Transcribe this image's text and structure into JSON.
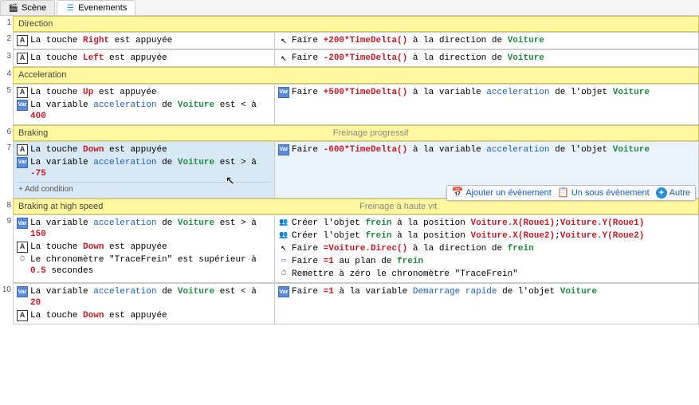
{
  "tabs": {
    "scene": "Scène",
    "events": "Evenements"
  },
  "groups": {
    "direction": {
      "title": "Direction",
      "subtitle": ""
    },
    "acceleration": {
      "title": "Acceleration",
      "subtitle": ""
    },
    "braking": {
      "title": "Braking",
      "subtitle": "Freinage progressif"
    },
    "braking_high": {
      "title": "Braking at high speed",
      "subtitle": "Freinage à haute vit"
    }
  },
  "text": {
    "la_touche": "La touche",
    "right": "Right",
    "left": "Left",
    "up": "Up",
    "down": "Down",
    "est_appuyee": "est appuyée",
    "la_variable": "La variable",
    "acceleration": "acceleration",
    "de": "de",
    "voiture": "Voiture",
    "est_lt_a": "est < à",
    "est_gt_a": "est > à",
    "v400": "400",
    "vn75": "-75",
    "v150": "150",
    "v20": "20",
    "le_chrono_prefix": "Le chronomètre \"TraceFrein\" est supérieur à",
    "v05s": "0.5",
    "secondes": "secondes",
    "faire": "Faire",
    "p200td": "+200*TimeDelta()",
    "n200td": "-200*TimeDelta()",
    "p500td": "+500*TimeDelta()",
    "n600td": "-600*TimeDelta()",
    "a_la_direction_de": "à la direction de",
    "a_la_variable": "à la variable",
    "de_lobjet": "de l'objet",
    "creer_lobjet": "Créer l'objet",
    "frein": "frein",
    "a_la_position": "à la position",
    "pos1": "Voiture.X(Roue1)",
    "pos1y": "Voiture.Y(Roue1)",
    "pos2": "Voiture.X(Roue2)",
    "pos2y": "Voiture.Y(Roue2)",
    "eq_direc": "=Voiture.Direc()",
    "eq1": "=1",
    "au_plan_de": "au plan de",
    "remettre_zero": "Remettre à zéro le chronomètre \"TraceFrein\"",
    "demarrage_rapide": "Demarrage rapide",
    "add_condition": "Add condition"
  },
  "toolbar": {
    "add_event": "Ajouter un évènement",
    "sub_event": "Un sous évènement",
    "other": "Autre"
  }
}
